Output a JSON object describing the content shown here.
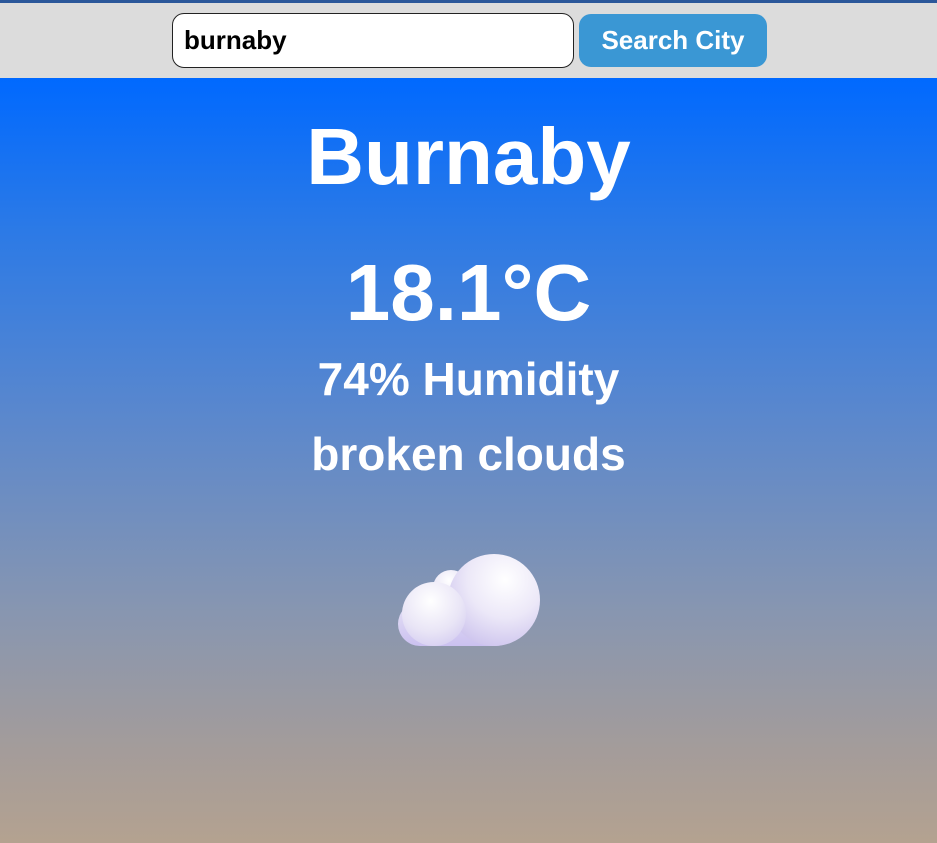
{
  "search": {
    "value": "burnaby",
    "button_label": "Search City"
  },
  "weather": {
    "city": "Burnaby",
    "temperature": "18.1°C",
    "humidity": "74% Humidity",
    "description": "broken clouds",
    "icon": "cloud-icon"
  },
  "colors": {
    "top_border": "#2b579a",
    "search_bar_bg": "#dcdcdc",
    "button_bg": "#3a97d4",
    "gradient_top": "#0069ff",
    "gradient_bottom": "#b4a290",
    "text": "#ffffff"
  }
}
